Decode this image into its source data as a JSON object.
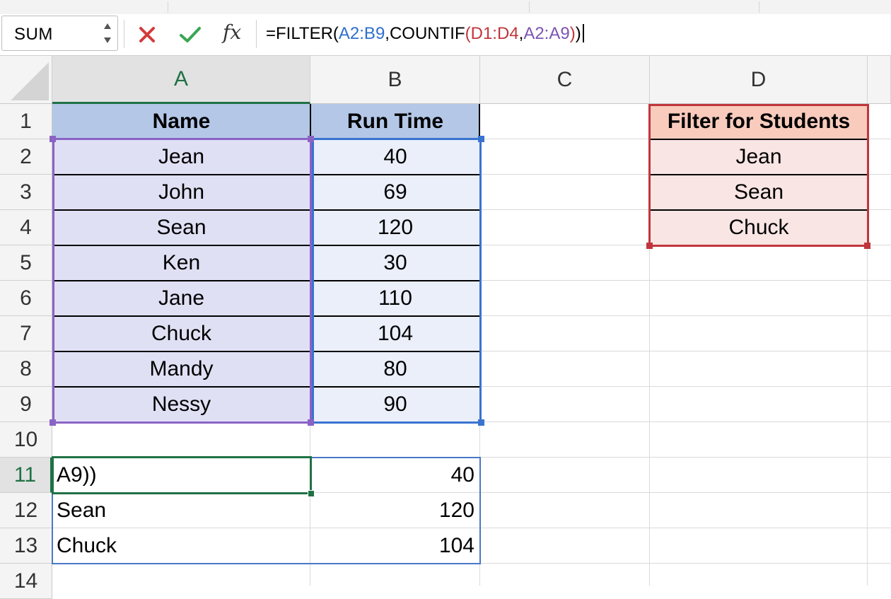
{
  "formula_bar": {
    "name_box": "SUM",
    "fx_label": "fx",
    "formula": {
      "part1": "=FILTER(",
      "ref_a2b9": "A2:B9",
      "part2": ",COUNTIF",
      "open_paren": "(",
      "ref_d1d4": "D1:D4",
      "comma": ",",
      "ref_a2a9": "A2:A9",
      "close1": ")",
      "close2": ")"
    }
  },
  "columns": [
    "A",
    "B",
    "C",
    "D"
  ],
  "rows": [
    "1",
    "2",
    "3",
    "4",
    "5",
    "6",
    "7",
    "8",
    "9",
    "10",
    "11",
    "12",
    "13",
    "14"
  ],
  "table": {
    "header_name": "Name",
    "header_time": "Run Time",
    "names": [
      "Jean",
      "John",
      "Sean",
      "Ken",
      "Jane",
      "Chuck",
      "Mandy",
      "Nessy"
    ],
    "times": [
      "40",
      "69",
      "120",
      "30",
      "110",
      "104",
      "80",
      "90"
    ]
  },
  "filter_list": {
    "header": "Filter for Students",
    "students": [
      "Jean",
      "Sean",
      "Chuck"
    ]
  },
  "results": {
    "names": [
      "A9))",
      "Sean",
      "Chuck"
    ],
    "times": [
      "40",
      "120",
      "104"
    ]
  },
  "colors": {
    "active_green": "#1f7145",
    "header_blue": "#b4c7e7",
    "range_purple": "#8a63c5",
    "range_blue": "#3a73d0",
    "range_red": "#c0363c",
    "filter_header_pink": "#f8cbbd"
  }
}
